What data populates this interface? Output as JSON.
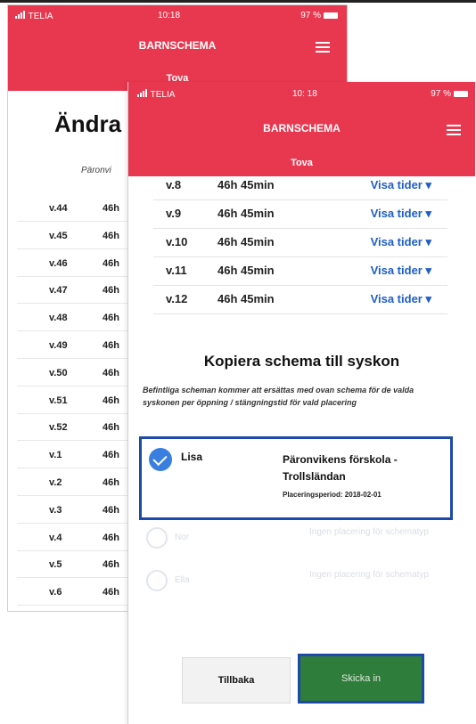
{
  "back_screen": {
    "status": {
      "carrier": "TELIA",
      "time": "10:18",
      "battery": "97 %"
    },
    "app_title": "BARNSCHEMA",
    "child_name": "Tova",
    "page_title": "Ändra",
    "school_label": "Päronvi",
    "rows": [
      {
        "week": "v.44",
        "hours": "46h"
      },
      {
        "week": "v.45",
        "hours": "46h"
      },
      {
        "week": "v.46",
        "hours": "46h"
      },
      {
        "week": "v.47",
        "hours": "46h"
      },
      {
        "week": "v.48",
        "hours": "46h"
      },
      {
        "week": "v.49",
        "hours": "46h"
      },
      {
        "week": "v.50",
        "hours": "46h"
      },
      {
        "week": "v.51",
        "hours": "46h"
      },
      {
        "week": "v.52",
        "hours": "46h"
      },
      {
        "week": "v.1",
        "hours": "46h"
      },
      {
        "week": "v.2",
        "hours": "46h"
      },
      {
        "week": "v.3",
        "hours": "46h"
      },
      {
        "week": "v.4",
        "hours": "46h"
      },
      {
        "week": "v.5",
        "hours": "46h"
      },
      {
        "week": "v.6",
        "hours": "46h"
      }
    ]
  },
  "front_screen": {
    "status": {
      "carrier": "TELIA",
      "time": "10: 18",
      "battery": "97 %"
    },
    "app_title": "BARNSCHEMA",
    "child_name": "Tova",
    "rows": [
      {
        "week": "v.8",
        "hours": "46h 45min",
        "link": "Visa tider ▾"
      },
      {
        "week": "v.9",
        "hours": "46h 45min",
        "link": "Visa tider ▾"
      },
      {
        "week": "v.10",
        "hours": "46h 45min",
        "link": "Visa tider ▾"
      },
      {
        "week": "v.11",
        "hours": "46h 45min",
        "link": "Visa tider ▾"
      },
      {
        "week": "v.12",
        "hours": "46h 45min",
        "link": "Visa tider ▾"
      }
    ],
    "copy_heading": "Kopiera schema till syskon",
    "copy_description": "Befintliga scheman kommer att ersättas med ovan schema för de valda syskonen per öppning / stängningstid för vald placering",
    "selected_sibling": {
      "name": "Lisa",
      "school": "Päronvikens förskola - Trollsländan",
      "placement": "Placeringsperiod: 2018-02-01"
    },
    "disabled_siblings": [
      {
        "name": "Nor",
        "note": "Ingen placering för schematyp"
      },
      {
        "name": "Ella",
        "note": "Ingen placering för schematyp"
      }
    ],
    "back_button": "Tillbaka",
    "send_button": "Skicka in"
  }
}
